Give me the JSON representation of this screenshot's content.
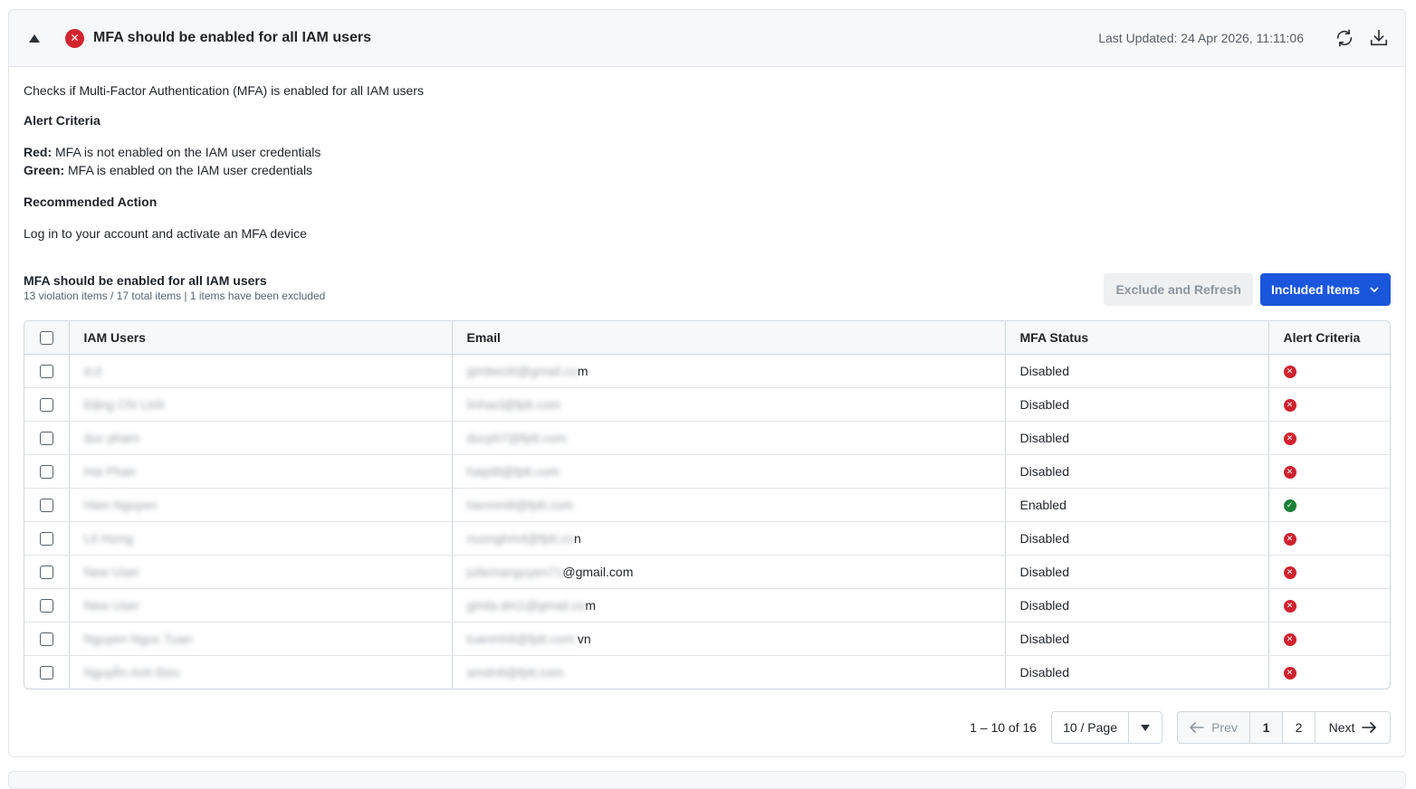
{
  "header": {
    "title": "MFA should be enabled for all IAM users",
    "last_updated": "Last Updated: 24 Apr 2026, 11:11:06"
  },
  "details": {
    "description": "Checks if Multi-Factor Authentication (MFA) is enabled for all IAM users",
    "alert_criteria_heading": "Alert Criteria",
    "red_label": "Red:",
    "red_text": " MFA is not enabled on the IAM user credentials",
    "green_label": "Green:",
    "green_text": " MFA is enabled on the IAM user credentials",
    "recommended_heading": "Recommended Action",
    "recommended_text": "Log in to your account and activate an MFA device"
  },
  "section": {
    "title": "MFA should be enabled for all IAM users",
    "meta": "13 violation items / 17 total items | 1 items have been excluded",
    "exclude_button": "Exclude and Refresh",
    "included_button": "Included Items"
  },
  "table": {
    "columns": [
      "IAM Users",
      "Email",
      "MFA Status",
      "Alert Criteria"
    ],
    "rows": [
      {
        "user": "d.d",
        "email_blur": "gimbeckt@gmail.co",
        "email_tail": "m",
        "status": "Disabled",
        "alert": "red"
      },
      {
        "user": "Đặng Chí Linh",
        "email_blur": "linhacl@fptt.com",
        "email_tail": "",
        "status": "Disabled",
        "alert": "red"
      },
      {
        "user": "duc pham",
        "email_blur": "ducph7@fptt.com",
        "email_tail": "",
        "status": "Disabled",
        "alert": "red"
      },
      {
        "user": "Hai Phan",
        "email_blur": "haipt8@fptt.com",
        "email_tail": "",
        "status": "Disabled",
        "alert": "red"
      },
      {
        "user": "Hien Nguyen",
        "email_blur": "hiennm8@fptt.com",
        "email_tail": "",
        "status": "Enabled",
        "alert": "green"
      },
      {
        "user": "Lê Hưng",
        "email_blur": "nuonghm4@fptt.co",
        "email_tail": "n",
        "status": "Disabled",
        "alert": "red"
      },
      {
        "user": "New User",
        "email_blur": "juliemanguyen71",
        "email_tail": "@gmail.com",
        "status": "Disabled",
        "alert": "red"
      },
      {
        "user": "New User",
        "email_blur": "gimla.dm1@gmail.co",
        "email_tail": "m",
        "status": "Disabled",
        "alert": "red"
      },
      {
        "user": "Nguyen Ngoc Tuan",
        "email_blur": "tuanmh8@fptt.com.",
        "email_tail": "vn",
        "status": "Disabled",
        "alert": "red"
      },
      {
        "user": "Nguyễn Anh Đức",
        "email_blur": "amdn8@fptt.com",
        "email_tail": "",
        "status": "Disabled",
        "alert": "red"
      }
    ]
  },
  "pagination": {
    "range": "1 – 10 of 16",
    "page_size": "10 / Page",
    "prev": "Prev",
    "pages": [
      "1",
      "2"
    ],
    "next": "Next"
  },
  "colors": {
    "red": "#cf222e",
    "green": "#1a7f37",
    "primary": "#1a56db"
  }
}
